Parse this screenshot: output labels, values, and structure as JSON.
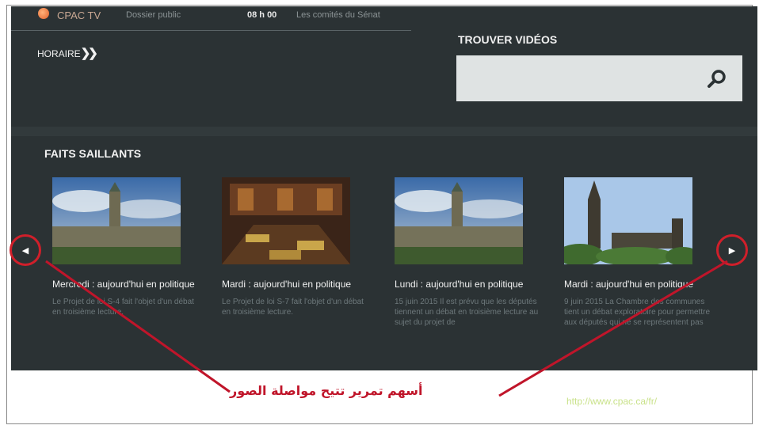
{
  "topbar": {
    "logo_text": "CPAC TV",
    "dossier": "Dossier public",
    "time": "08 h 00",
    "program": "Les comités du Sénat"
  },
  "horaire": {
    "label": "HORAIRE",
    "arrows": "❯❯"
  },
  "search": {
    "title": "TROUVER VIDÉOS",
    "value": ""
  },
  "highlights": {
    "title": "FAITS SAILLANTS",
    "cards": [
      {
        "title": "Mercredi : aujourd'hui en politique",
        "desc": "Le Projet de loi S-4 fait l'objet d'un débat en troisième lecture."
      },
      {
        "title": "Mardi : aujourd'hui en politique",
        "desc": "Le Projet de loi S-7 fait l'objet d'un débat en troisième lecture."
      },
      {
        "title": "Lundi : aujourd'hui en politique",
        "desc": "15 juin 2015 Il est prévu que les députés tiennent un débat en troisième lecture au sujet du projet de"
      },
      {
        "title": "Mardi : aujourd'hui en politique",
        "desc": "9 juin 2015 La Chambre des communes tient un débat exploratoire pour permettre aux députés qui ne se représentent pas"
      }
    ]
  },
  "nav": {
    "prev": "◀",
    "next": "▶"
  },
  "annotation": "أسهم تمرير تتيح مواصلة الصور",
  "url": "http://www.cpac.ca/fr/",
  "colors": {
    "background": "#2b3234",
    "annotation": "#c0152a",
    "circle": "#d01f2a"
  }
}
